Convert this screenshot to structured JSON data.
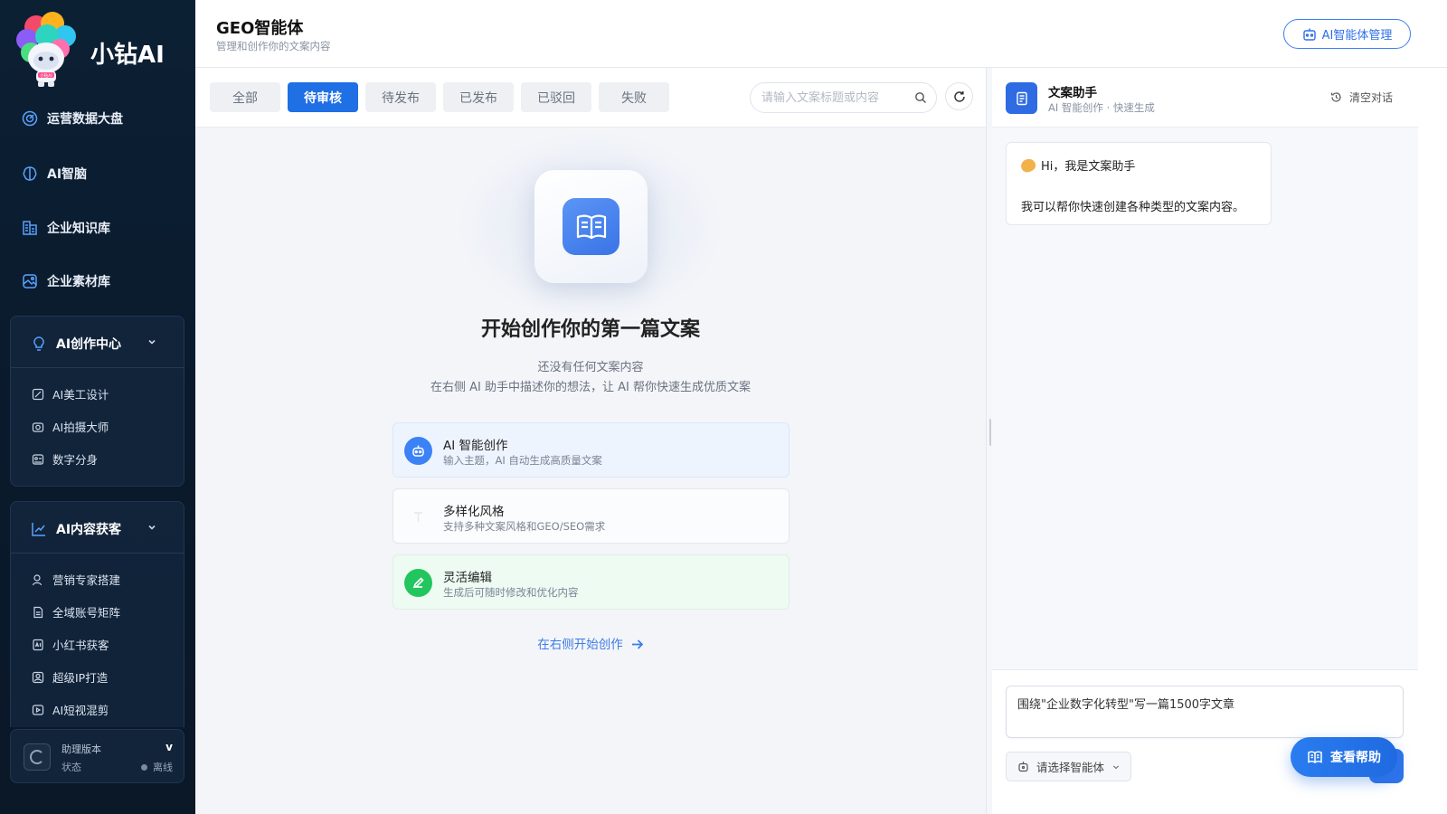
{
  "brand": {
    "name": "小钻AI",
    "logo_badge": "小钻AI"
  },
  "sidebar": {
    "items": [
      {
        "label": "运营数据大盘",
        "icon": "dashboard-icon"
      },
      {
        "label": "AI智脑",
        "icon": "brain-icon"
      },
      {
        "label": "企业知识库",
        "icon": "knowledge-icon"
      },
      {
        "label": "企业素材库",
        "icon": "image-icon"
      }
    ],
    "groups": [
      {
        "label": "AI创作中心",
        "icon": "bulb-icon",
        "items": [
          {
            "label": "AI美工设计"
          },
          {
            "label": "AI拍摄大师"
          },
          {
            "label": "数字分身"
          }
        ]
      },
      {
        "label": "AI内容获客",
        "icon": "chart-icon",
        "items": [
          {
            "label": "营销专家搭建"
          },
          {
            "label": "全域账号矩阵"
          },
          {
            "label": "小红书获客"
          },
          {
            "label": "超级IP打造"
          },
          {
            "label": "AI短视混剪"
          }
        ]
      }
    ],
    "footer": {
      "version_label": "助理版本",
      "version_value": "v",
      "status_label": "状态",
      "status_value": "离线"
    }
  },
  "header": {
    "title": "GEO智能体",
    "subtitle": "管理和创作你的文案内容",
    "manage_button": "AI智能体管理"
  },
  "tabs": [
    {
      "label": "全部",
      "active": false
    },
    {
      "label": "待审核",
      "active": true
    },
    {
      "label": "待发布",
      "active": false
    },
    {
      "label": "已发布",
      "active": false
    },
    {
      "label": "已驳回",
      "active": false
    },
    {
      "label": "失败",
      "active": false
    }
  ],
  "search": {
    "placeholder": "请输入文案标题或内容"
  },
  "empty_state": {
    "title": "开始创作你的第一篇文案",
    "desc1": "还没有任何文案内容",
    "desc2": "在右侧 AI 助手中描述你的想法，让 AI 帮你快速生成优质文案",
    "features": [
      {
        "title": "AI 智能创作",
        "desc": "输入主题，AI 自动生成高质量文案",
        "icon": "robot-icon",
        "color": "#3b82f6"
      },
      {
        "title": "多样化风格",
        "desc": "支持多种文案风格和GEO/SEO需求",
        "icon": "text-icon",
        "color": "#e5e7eb"
      },
      {
        "title": "灵活编辑",
        "desc": "生成后可随时修改和优化内容",
        "icon": "pencil-icon",
        "color": "#22c55e"
      }
    ],
    "cta": "在右侧开始创作"
  },
  "assistant": {
    "title": "文案助手",
    "subtitle": "AI 智能创作 · 快速生成",
    "clear_label": "清空对话",
    "greeting": "Hi，我是文案助手",
    "message": "我可以帮你快速创建各种类型的文案内容。",
    "input_value": "围绕\"企业数字化转型\"写一篇1500字文章",
    "agent_select": "请选择智能体",
    "help_button": "查看帮助"
  },
  "colors": {
    "accent": "#1f6fe5",
    "sidebar_bg": "#0c2034",
    "success": "#22c55e"
  }
}
